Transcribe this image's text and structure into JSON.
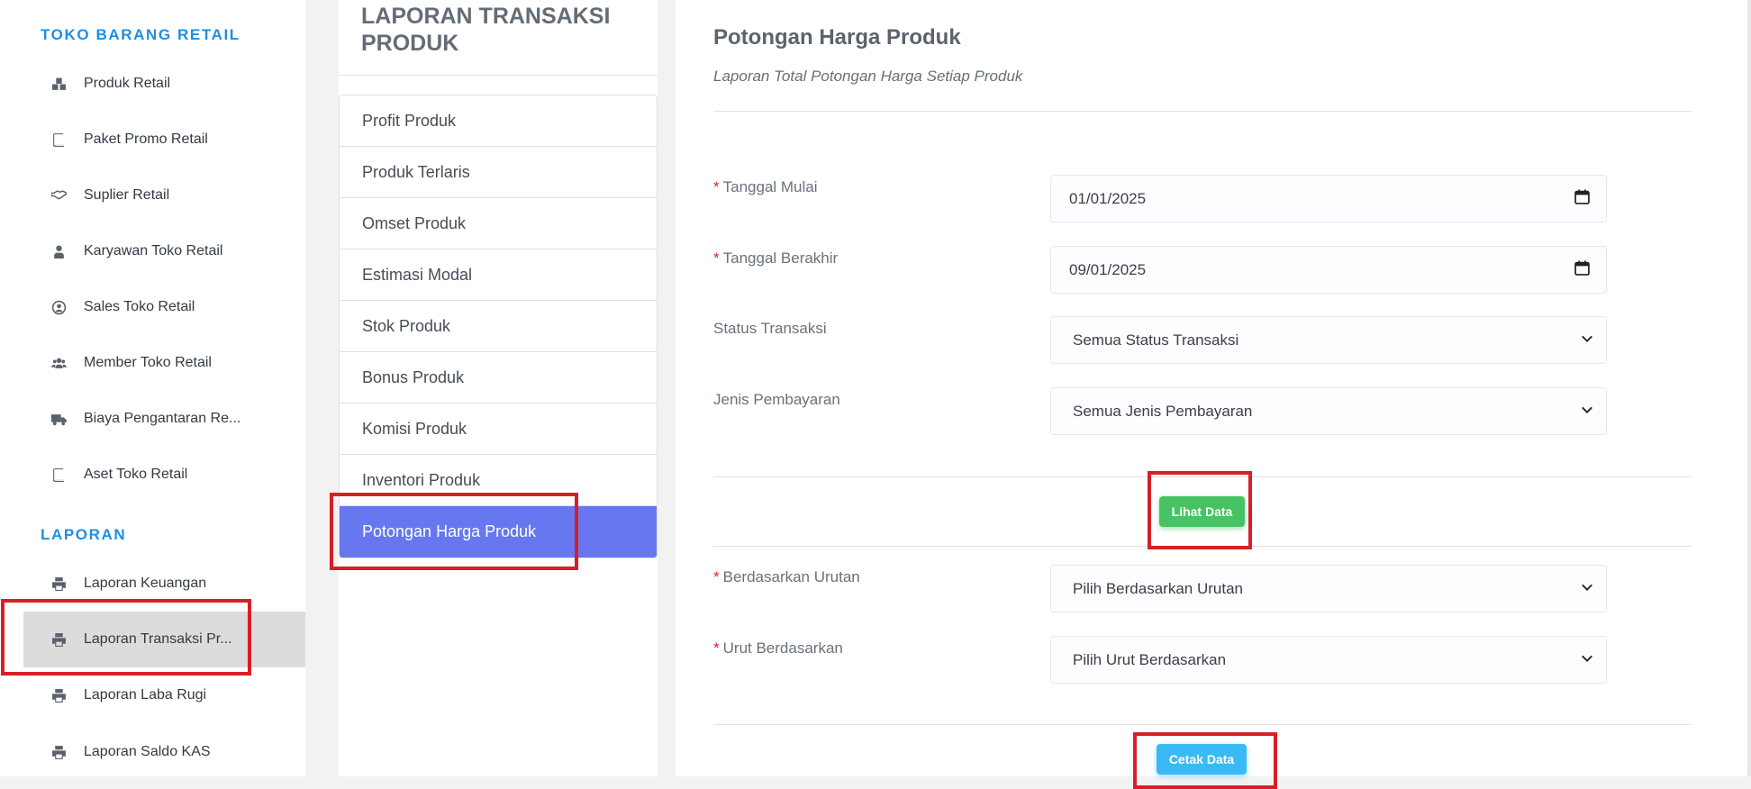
{
  "sidebar": {
    "sections": [
      {
        "title": "TOKO BARANG RETAIL"
      },
      {
        "title": "LAPORAN"
      }
    ],
    "items": [
      {
        "label": "Produk Retail",
        "icon": "cubes-icon"
      },
      {
        "label": "Paket Promo Retail",
        "icon": "book-icon"
      },
      {
        "label": "Suplier Retail",
        "icon": "handshake-icon"
      },
      {
        "label": "Karyawan Toko Retail",
        "icon": "user-tie-icon"
      },
      {
        "label": "Sales Toko Retail",
        "icon": "user-circle-icon"
      },
      {
        "label": "Member Toko Retail",
        "icon": "users-icon"
      },
      {
        "label": "Biaya Pengantaran Re...",
        "icon": "truck-icon"
      },
      {
        "label": "Aset Toko Retail",
        "icon": "book-icon"
      },
      {
        "label": "Laporan Keuangan",
        "icon": "print-icon"
      },
      {
        "label": "Laporan Transaksi Pr...",
        "icon": "print-icon",
        "active": true
      },
      {
        "label": "Laporan Laba Rugi",
        "icon": "print-icon"
      },
      {
        "label": "Laporan Saldo KAS",
        "icon": "print-icon"
      }
    ]
  },
  "report_menu": {
    "title": "LAPORAN TRANSAKSI PRODUK",
    "items": [
      {
        "label": "Profit Produk"
      },
      {
        "label": "Produk Terlaris"
      },
      {
        "label": "Omset Produk"
      },
      {
        "label": "Estimasi Modal"
      },
      {
        "label": "Stok Produk"
      },
      {
        "label": "Bonus Produk"
      },
      {
        "label": "Komisi Produk"
      },
      {
        "label": "Inventori Produk"
      },
      {
        "label": "Potongan Harga Produk",
        "active": true
      }
    ]
  },
  "main": {
    "title": "Potongan Harga Produk",
    "subtitle": "Laporan Total Potongan Harga Setiap Produk",
    "required_mark": "*",
    "fields": {
      "start_date": {
        "label": "Tanggal Mulai",
        "value": "01/01/2025"
      },
      "end_date": {
        "label": "Tanggal Berakhir",
        "value": "09/01/2025"
      },
      "status": {
        "label": "Status Transaksi",
        "value": "Semua Status Transaksi"
      },
      "payment": {
        "label": "Jenis Pembayaran",
        "value": "Semua Jenis Pembayaran"
      },
      "order_by": {
        "label": "Berdasarkan Urutan",
        "value": "Pilih Berdasarkan Urutan"
      },
      "sort_by": {
        "label": "Urut Berdasarkan",
        "value": "Pilih Urut Berdasarkan"
      }
    },
    "view_button": "Lihat Data",
    "print_button": "Cetak Data"
  },
  "colors": {
    "sidebar_section": "#1e8fe0",
    "menu_active": "#6777ef",
    "button_green": "#47c363",
    "button_blue": "#3abaf4",
    "highlight": "#d71f27",
    "required": "#e0252b"
  }
}
